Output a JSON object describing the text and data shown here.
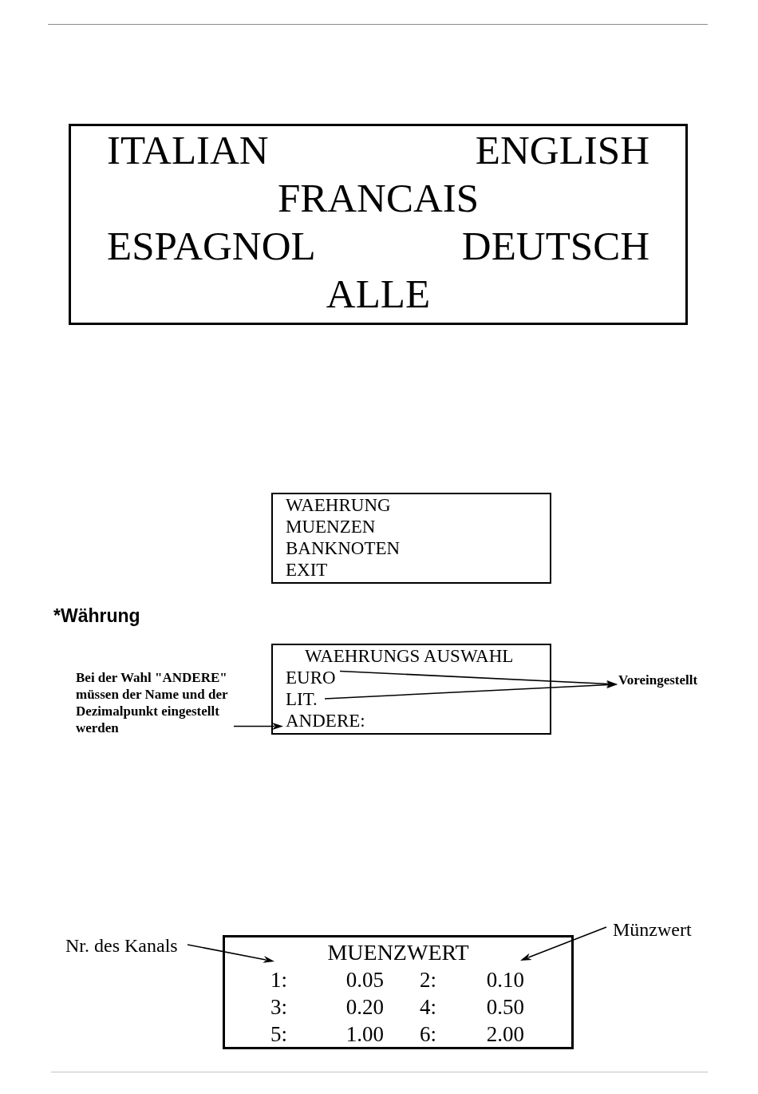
{
  "language_menu": {
    "rows": [
      {
        "items": [
          "ITALIAN",
          "ENGLISH"
        ]
      },
      {
        "items": [
          "FRANCAIS"
        ]
      },
      {
        "items": [
          "ESPAGNOL",
          "DEUTSCH"
        ]
      },
      {
        "items": [
          "ALLE"
        ]
      }
    ]
  },
  "main_menu": {
    "items": [
      "WAEHRUNG",
      "MUENZEN",
      "BANKNOTEN",
      "EXIT"
    ]
  },
  "section_heading": "*Währung",
  "currency_menu": {
    "title": "WAEHRUNGS AUSWAHL",
    "items": [
      "EURO",
      "LIT.",
      "ANDERE:"
    ],
    "annotations": {
      "left_note": "Bei der Wahl \"ANDERE\" müssen der Name und der Dezimalpunkt eingestellt werden",
      "right_label": "Voreingestellt"
    }
  },
  "coin_value_screen": {
    "title": "MUENZWERT",
    "entries": [
      {
        "channel": "1:",
        "value": "0.05"
      },
      {
        "channel": "2:",
        "value": "0.10"
      },
      {
        "channel": "3:",
        "value": "0.20"
      },
      {
        "channel": "4:",
        "value": "0.50"
      },
      {
        "channel": "5:",
        "value": "1.00"
      },
      {
        "channel": "6:",
        "value": "2.00"
      }
    ],
    "annotations": {
      "left_label": "Nr. des Kanals",
      "right_label": "Münzwert"
    }
  }
}
